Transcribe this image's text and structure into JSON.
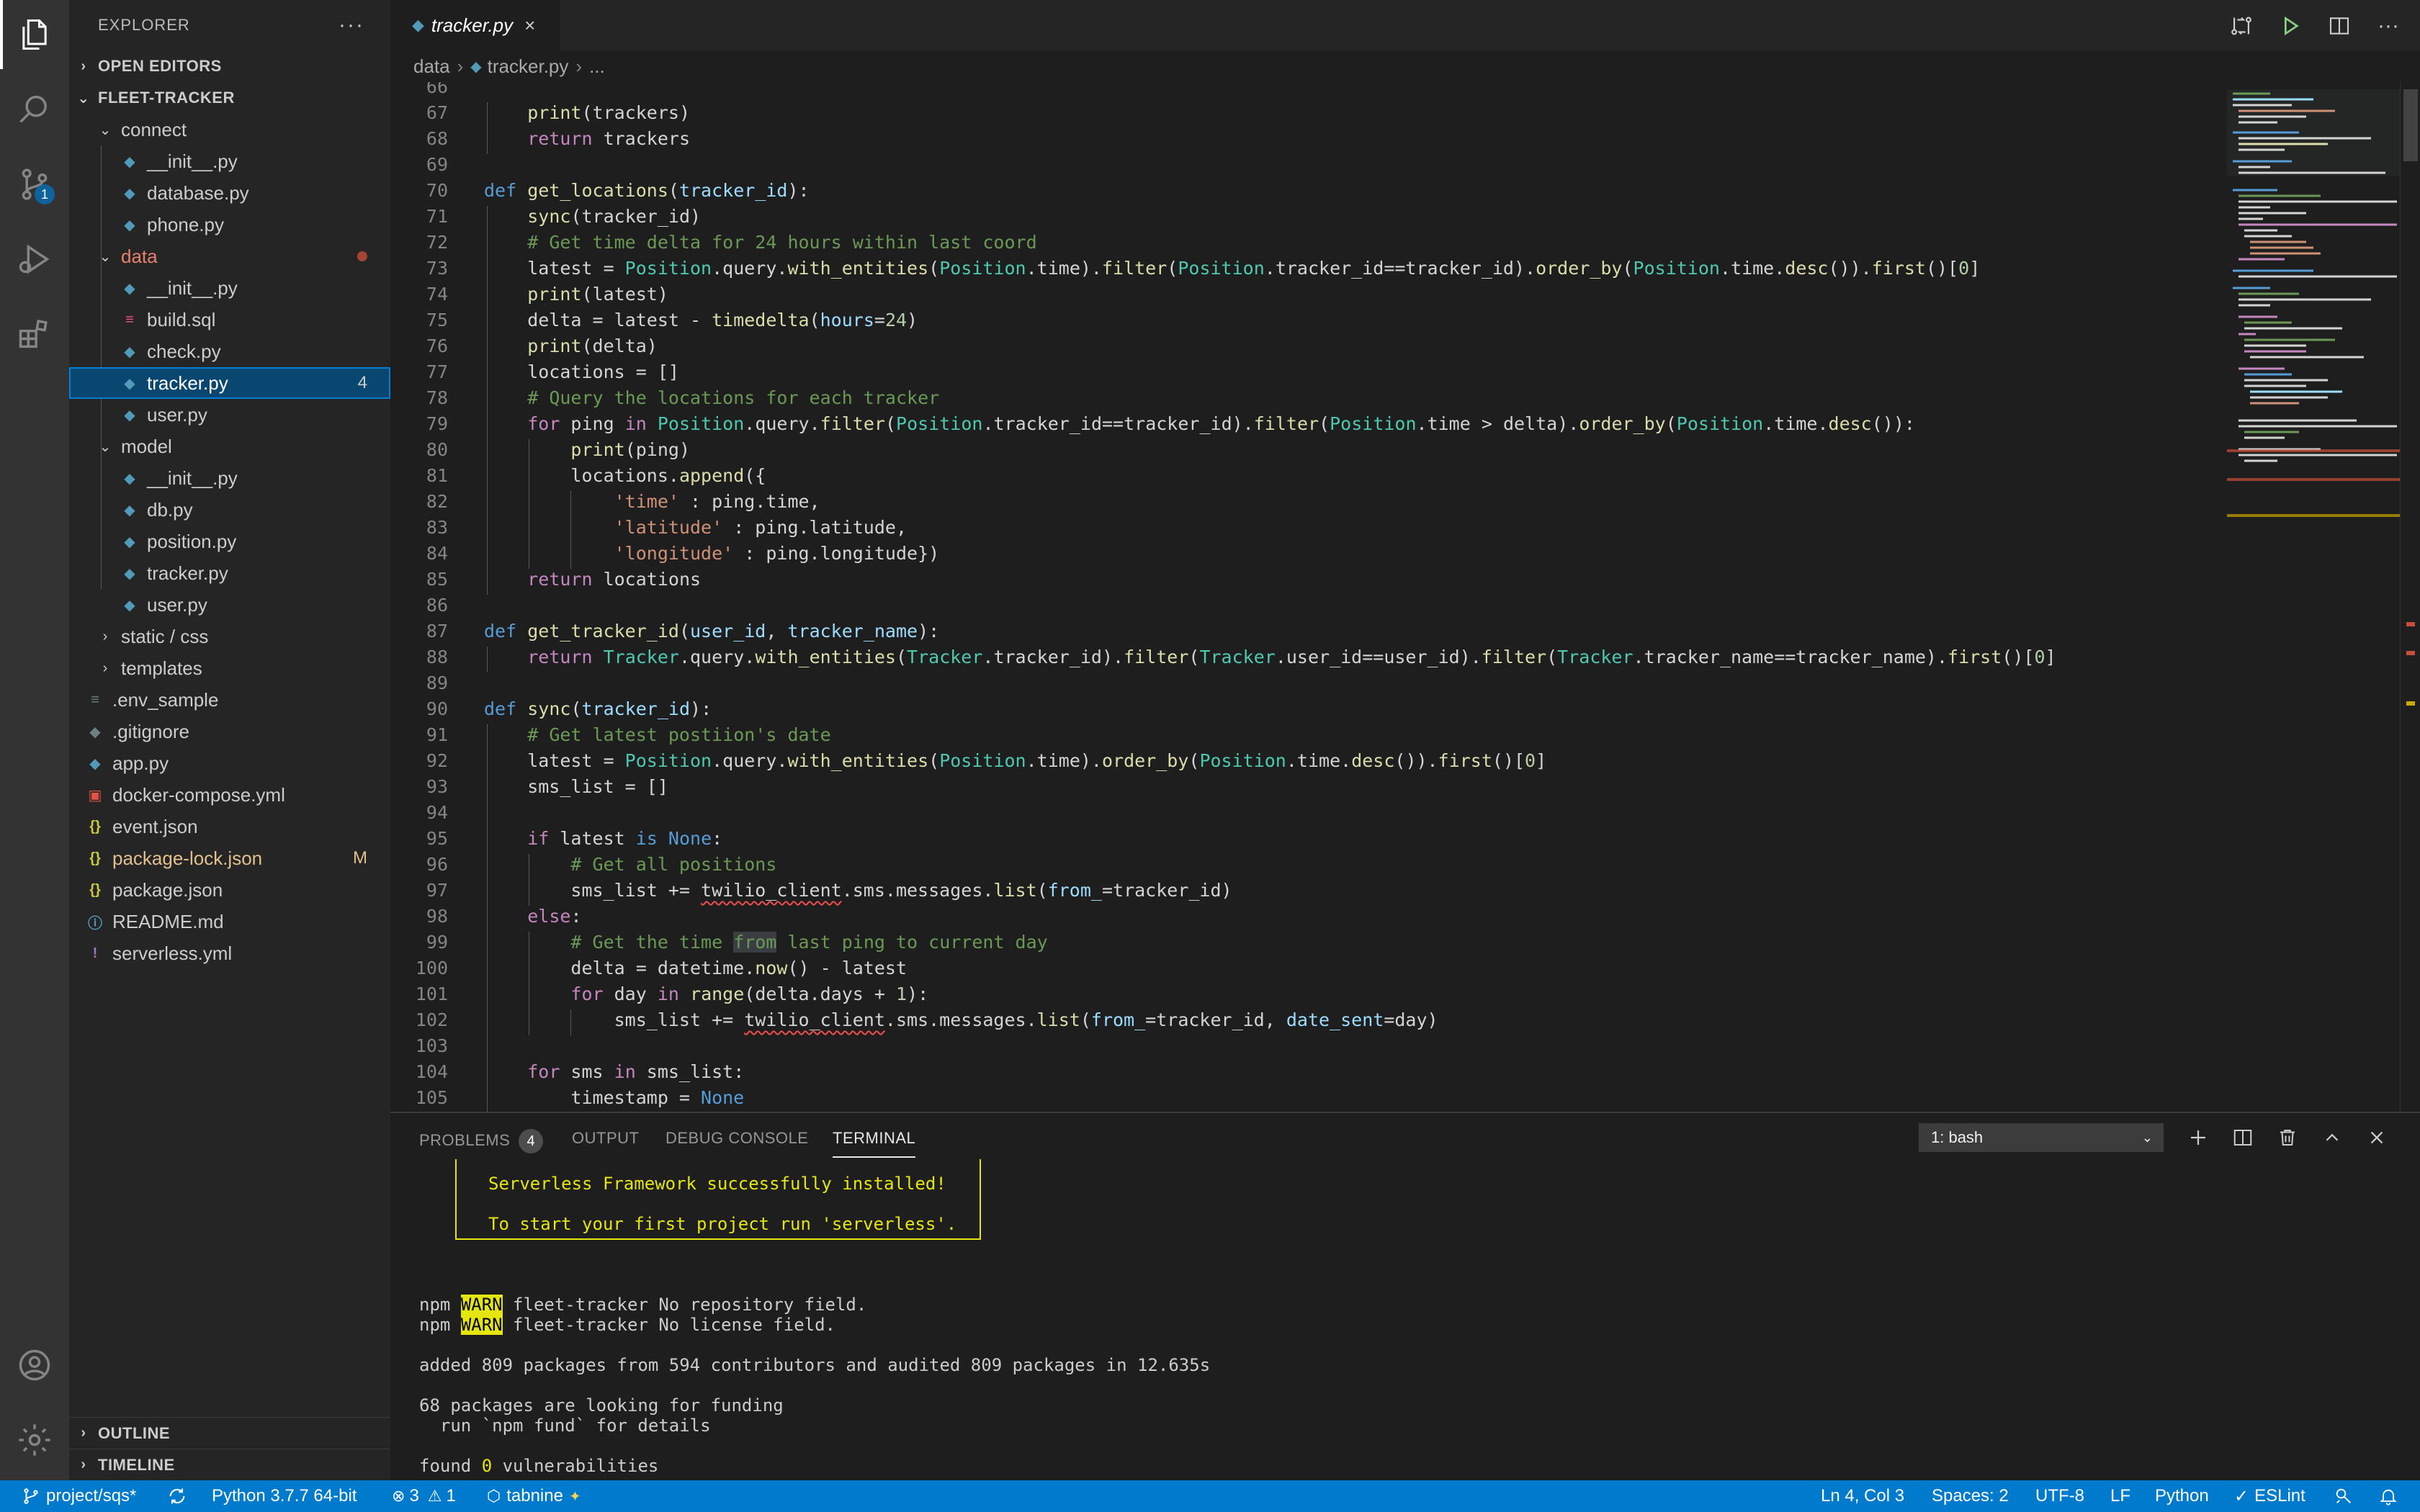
{
  "explorer": {
    "title": "EXPLORER",
    "open_editors": "OPEN EDITORS",
    "project": "FLEET-TRACKER",
    "outline": "OUTLINE",
    "timeline": "TIMELINE",
    "items": [
      {
        "label": "connect",
        "type": "folder"
      },
      {
        "label": "__init__.py",
        "type": "py"
      },
      {
        "label": "database.py",
        "type": "py"
      },
      {
        "label": "phone.py",
        "type": "py"
      },
      {
        "label": "data",
        "type": "folder"
      },
      {
        "label": "__init__.py",
        "type": "py"
      },
      {
        "label": "build.sql",
        "type": "sql"
      },
      {
        "label": "check.py",
        "type": "py"
      },
      {
        "label": "tracker.py",
        "type": "py",
        "badge": "4"
      },
      {
        "label": "user.py",
        "type": "py"
      },
      {
        "label": "model",
        "type": "folder"
      },
      {
        "label": "__init__.py",
        "type": "py"
      },
      {
        "label": "db.py",
        "type": "py"
      },
      {
        "label": "position.py",
        "type": "py"
      },
      {
        "label": "tracker.py",
        "type": "py"
      },
      {
        "label": "user.py",
        "type": "py"
      },
      {
        "label": "static / css",
        "type": "folder"
      },
      {
        "label": "templates",
        "type": "folder"
      },
      {
        "label": ".env_sample",
        "type": "env"
      },
      {
        "label": ".gitignore",
        "type": "git"
      },
      {
        "label": "app.py",
        "type": "py"
      },
      {
        "label": "docker-compose.yml",
        "type": "docker"
      },
      {
        "label": "event.json",
        "type": "json"
      },
      {
        "label": "package-lock.json",
        "type": "json",
        "badge": "M"
      },
      {
        "label": "package.json",
        "type": "json"
      },
      {
        "label": "README.md",
        "type": "md"
      },
      {
        "label": "serverless.yml",
        "type": "yml"
      }
    ]
  },
  "activity": {
    "scm_badge": "1"
  },
  "tab": {
    "label": "tracker.py",
    "close": "×"
  },
  "breadcrumb": {
    "folder": "data",
    "file": "tracker.py",
    "more": "..."
  },
  "editor": {
    "line_numbers": [
      "66",
      "67",
      "68",
      "69",
      "70",
      "71",
      "72",
      "73",
      "74",
      "75",
      "76",
      "77",
      "78",
      "79",
      "80",
      "81",
      "82",
      "83",
      "84",
      "85",
      "86",
      "87",
      "88",
      "89",
      "90",
      "91",
      "92",
      "93",
      "94",
      "95",
      "96",
      "97",
      "98",
      "99",
      "100",
      "101",
      "102",
      "103",
      "104",
      "105"
    ]
  },
  "panel": {
    "tabs": [
      "PROBLEMS",
      "OUTPUT",
      "DEBUG CONSOLE",
      "TERMINAL"
    ],
    "problems_count": "4",
    "terminal_select": "1: bash",
    "terminal": {
      "box_line1": "Serverless Framework successfully installed!",
      "box_line2": "To start your first project run 'serverless'.",
      "npm": "npm",
      "warn": "WARN",
      "warn1": " fleet-tracker No repository field.",
      "warn2": " fleet-tracker No license field.",
      "added": "added 809 packages from 594 contributors and audited 809 packages in 12.635s",
      "funding1": "68 packages are looking for funding",
      "funding2": "  run `npm fund` for details",
      "found_pre": "found ",
      "found_num": "0",
      "found_post": " vulnerabilities"
    }
  },
  "status": {
    "branch": "project/sqs*",
    "python": "Python 3.7.7 64-bit",
    "errors": "3",
    "warnings": "1",
    "tabnine": "tabnine",
    "position": "Ln 4, Col 3",
    "spaces": "Spaces: 2",
    "encoding": "UTF-8",
    "eol": "LF",
    "language": "Python",
    "eslint": "ESLint"
  },
  "colors": {
    "accent": "#007acc",
    "selection": "#094771",
    "modified": "#e2c08d",
    "error_dot": "#c74e39"
  }
}
